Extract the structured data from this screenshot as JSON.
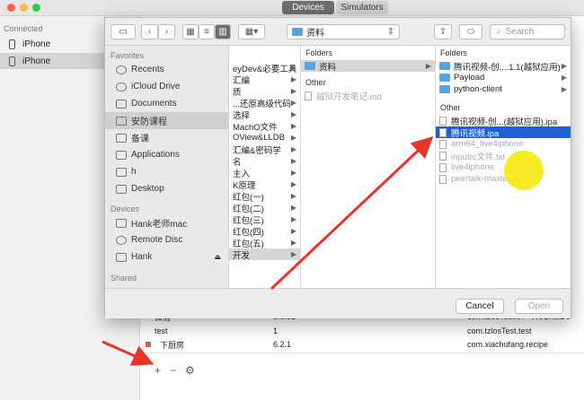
{
  "titlebar": {
    "tabs": [
      "Devices",
      "Simulators"
    ],
    "active": 0
  },
  "devices": {
    "header": "Connected",
    "items": [
      {
        "label": "iPhone",
        "selected": false
      },
      {
        "label": "iPhone",
        "selected": true
      }
    ]
  },
  "app_table": {
    "rows": [
      {
        "name": "微信",
        "version": "6.6.02",
        "bundle": "com.tzosTest.07--WeChatDe"
      },
      {
        "name": "test",
        "version": "1",
        "bundle": "com.tzlosTest.test"
      },
      {
        "name": "下厨房",
        "version": "6.2.1",
        "bundle": "com.xiachufang.recipe"
      }
    ]
  },
  "bottom_tools": {
    "add": "+",
    "remove": "−"
  },
  "dialog": {
    "toolbar": {
      "path": "资料",
      "search_placeholder": "Search",
      "back": "‹",
      "forward": "›"
    },
    "sidebar": {
      "favorites_header": "Favorites",
      "favorites": [
        {
          "label": "Recents",
          "icon": "clock-icon"
        },
        {
          "label": "iCloud Drive",
          "icon": "cloud-icon"
        },
        {
          "label": "Documents",
          "icon": "document-icon"
        },
        {
          "label": "安防课程",
          "icon": "folder-icon",
          "selected": true
        },
        {
          "label": "备课",
          "icon": "folder-icon"
        },
        {
          "label": "Applications",
          "icon": "applications-icon"
        },
        {
          "label": "h",
          "icon": "home-icon"
        },
        {
          "label": "Desktop",
          "icon": "desktop-icon"
        }
      ],
      "devices_header": "Devices",
      "devices": [
        {
          "label": "Hank老师mac",
          "icon": "computer-icon"
        },
        {
          "label": "Remote Disc",
          "icon": "disc-icon"
        },
        {
          "label": "Hank",
          "icon": "drive-icon"
        }
      ],
      "shared_header": "Shared"
    },
    "col1": {
      "items": [
        "eyDev&必要工具",
        "汇编",
        "质",
        "...还原高级代码",
        "选择",
        "MachO文件",
        "OView&LLDB",
        "汇编&密码学",
        "名",
        "主入",
        "K原理",
        "红包(一)",
        "红包(二)",
        "红包(三)",
        "红包(四)",
        "红包(五)",
        "开发"
      ]
    },
    "col2": {
      "folders_header": "Folders",
      "folders": [
        "资料"
      ],
      "other_header": "Other",
      "other": [
        "越狱开发笔记.md"
      ]
    },
    "col3": {
      "folders_header": "Folders",
      "folders": [
        "腾讯视频-创....1.1(越狱应用)",
        "Payload",
        "python-client"
      ],
      "other_header": "Other",
      "other": [
        {
          "label": "腾讯视频-创...(越狱应用).ipa",
          "dim": false
        },
        {
          "label": "腾讯视频.ipa",
          "dim": false,
          "highlight": true
        },
        {
          "label": "arm64_live4iphone",
          "dim": true
        },
        {
          "label": "inputrc文件.txt",
          "dim": true
        },
        {
          "label": "live4iphone",
          "dim": true
        },
        {
          "label": "peertalk-master.zip",
          "dim": true
        }
      ]
    },
    "footer": {
      "cancel": "Cancel",
      "open": "Open"
    }
  }
}
